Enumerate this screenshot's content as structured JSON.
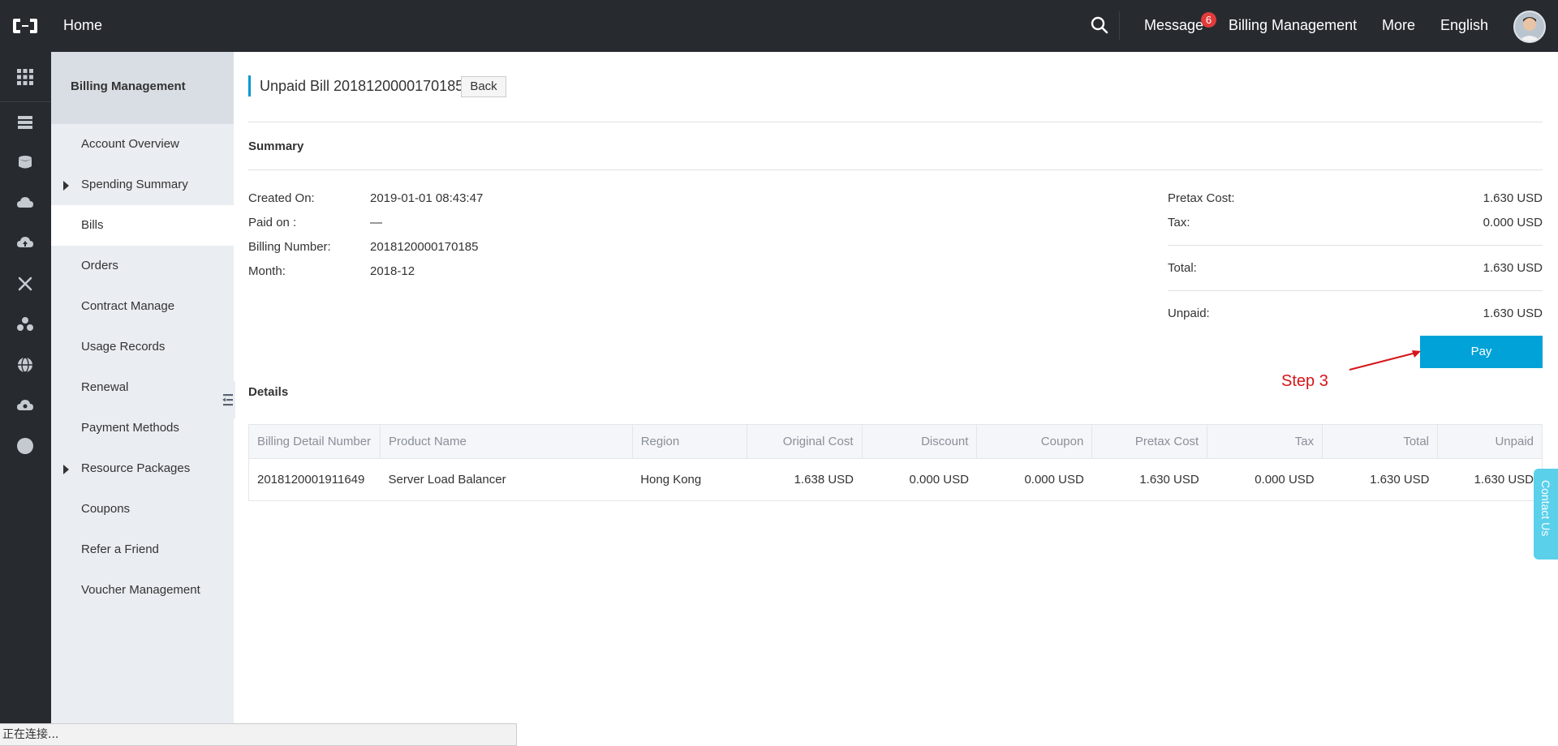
{
  "topbar": {
    "home_label": "Home",
    "nav": {
      "message": "Message",
      "message_badge": "6",
      "billing": "Billing Management",
      "more": "More",
      "language": "English"
    }
  },
  "sidebar": {
    "title": "Billing Management",
    "items": [
      {
        "label": "Account Overview",
        "expandable": false
      },
      {
        "label": "Spending Summary",
        "expandable": true
      },
      {
        "label": "Bills",
        "expandable": false,
        "active": true
      },
      {
        "label": "Orders",
        "expandable": false
      },
      {
        "label": "Contract Manage",
        "expandable": false
      },
      {
        "label": "Usage Records",
        "expandable": false
      },
      {
        "label": "Renewal",
        "expandable": false
      },
      {
        "label": "Payment Methods",
        "expandable": false
      },
      {
        "label": "Resource Packages",
        "expandable": true
      },
      {
        "label": "Coupons",
        "expandable": false
      },
      {
        "label": "Refer a Friend",
        "expandable": false
      },
      {
        "label": "Voucher Management",
        "expandable": false
      }
    ]
  },
  "main": {
    "title": "Unpaid Bill 2018120000170185",
    "back_label": "Back",
    "summary_title": "Summary",
    "summary_left": [
      {
        "label": "Created On:",
        "value": "2019-01-01 08:43:47"
      },
      {
        "label": "Paid on :",
        "value": "—"
      },
      {
        "label": "Billing Number:",
        "value": "2018120000170185"
      },
      {
        "label": "Month:",
        "value": "2018-12"
      }
    ],
    "summary_right": {
      "pretax_label": "Pretax Cost:",
      "pretax_value": "1.630 USD",
      "tax_label": "Tax:",
      "tax_value": "0.000 USD",
      "total_label": "Total:",
      "total_value": "1.630 USD",
      "unpaid_label": "Unpaid:",
      "unpaid_value": "1.630 USD"
    },
    "pay_label": "Pay",
    "annotation": "Step 3",
    "details_title": "Details",
    "table": {
      "columns": [
        "Billing Detail Number",
        "Product Name",
        "Region",
        "Original Cost",
        "Discount",
        "Coupon",
        "Pretax Cost",
        "Tax",
        "Total",
        "Unpaid"
      ],
      "rows": [
        [
          "2018120001911649",
          "Server Load Balancer",
          "Hong Kong",
          "1.638 USD",
          "0.000 USD",
          "0.000 USD",
          "1.630 USD",
          "0.000 USD",
          "1.630 USD",
          "1.630 USD"
        ]
      ]
    }
  },
  "contact_label": "Contact Us",
  "status_bar": "正在连接...",
  "colors": {
    "topbar": "#272b30",
    "accent": "#00a2d8",
    "link": "#1f6fb5",
    "annotation": "#d6151a"
  }
}
